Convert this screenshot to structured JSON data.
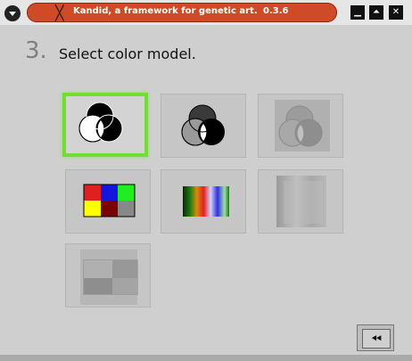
{
  "window": {
    "title": "Kandid, a framework for genetic art.",
    "version": "0.3.6",
    "app_icon": "x-icon",
    "menu_icon": "chevron-down-icon",
    "minimize_icon": "minimize-icon",
    "maximize_icon": "maximize-icon",
    "close_icon": "close-icon"
  },
  "step": {
    "number": "3.",
    "title": "Select color model."
  },
  "options": [
    {
      "name": "black-white-venn",
      "selected": true
    },
    {
      "name": "gray-venn",
      "selected": false
    },
    {
      "name": "faded-venn",
      "selected": false
    },
    {
      "name": "color-palette",
      "selected": false
    },
    {
      "name": "spectrum",
      "selected": false
    },
    {
      "name": "gray-gradient",
      "selected": false
    },
    {
      "name": "gray-blocks",
      "selected": false
    }
  ],
  "nav": {
    "back_icon": "rewind-icon"
  },
  "colors": {
    "title_pill": "#cf4a26",
    "selection": "#74dd34",
    "palette": [
      "#e02020",
      "#1515e0",
      "#20ee20",
      "#ffff00",
      "#7a0000",
      "#888888"
    ]
  }
}
